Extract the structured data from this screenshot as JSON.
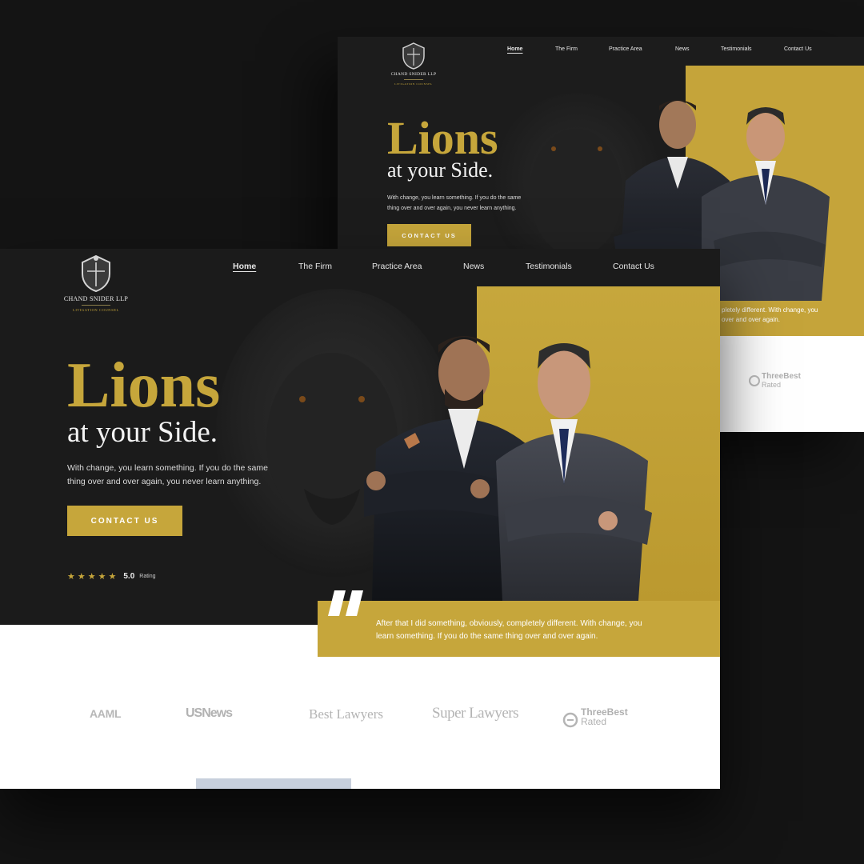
{
  "brand": {
    "firm_name": "CHAND SNIDER LLP",
    "tagline": "LITIGATION COUNSEL"
  },
  "nav": {
    "items": [
      "Home",
      "The Firm",
      "Practice Area",
      "News",
      "Testimonials",
      "Contact Us"
    ],
    "active": "Home"
  },
  "hero": {
    "title": "Lions",
    "subtitle": "at your Side.",
    "description_line1": "With change, you learn something. If you do the same",
    "description_line2": "thing over and over again, you never learn anything.",
    "cta_label": "CONTACT US"
  },
  "rating": {
    "stars": 5,
    "value": "5.0",
    "label": "Rating"
  },
  "quote": {
    "mark": "”",
    "line1": "After that I did something, obviously, completely different. With change, you",
    "line2": "learn something. If you do the same thing over and over again."
  },
  "back_quote": {
    "line1": "pletely different. With change, you",
    "line2": "over and over again."
  },
  "press_logos": [
    {
      "name": "AAML",
      "icon": "aaml-logo"
    },
    {
      "name": "USNews",
      "icon": "usnews-logo"
    },
    {
      "name": "Best Lawyers",
      "icon": "best-lawyers-logo"
    },
    {
      "name": "Super Lawyers",
      "icon": "super-lawyers-logo"
    },
    {
      "name": "ThreeBest",
      "sub": "Rated",
      "icon": "threebest-logo"
    }
  ],
  "colors": {
    "gold": "#c6a63b",
    "dark": "#1a1a1a",
    "background": "#141414"
  }
}
